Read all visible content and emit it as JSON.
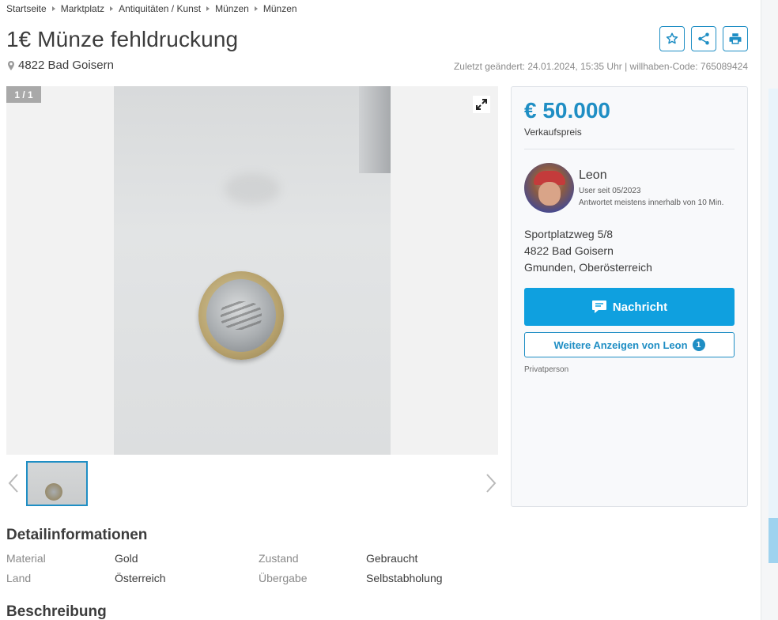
{
  "breadcrumb": [
    "Startseite",
    "Marktplatz",
    "Antiquitäten / Kunst",
    "Münzen",
    "Münzen"
  ],
  "listing": {
    "title": "1€ Münze fehldruckung",
    "location": "4822 Bad Goisern",
    "meta": "Zuletzt geändert: 24.01.2024, 15:35 Uhr | willhaben-Code: 765089424"
  },
  "actions": {
    "icons": [
      "star-icon",
      "share-icon",
      "print-icon"
    ]
  },
  "gallery": {
    "counter": "1 / 1"
  },
  "seller": {
    "price": "€ 50.000",
    "price_label": "Verkaufspreis",
    "name": "Leon",
    "user_since": "User seit 05/2023",
    "response_time": "Antwortet meistens innerhalb von 10 Min.",
    "address": {
      "street": "Sportplatzweg 5/8",
      "city": "4822 Bad Goisern",
      "region": "Gmunden, Oberösterreich"
    },
    "message_button": "Nachricht",
    "more_ads_button": "Weitere Anzeigen von Leon",
    "more_ads_count": "1",
    "seller_type": "Privatperson"
  },
  "details": {
    "title": "Detailinformationen",
    "rows": [
      {
        "label1": "Material",
        "value1": "Gold",
        "label2": "Zustand",
        "value2": "Gebraucht"
      },
      {
        "label1": "Land",
        "value1": "Österreich",
        "label2": "Übergabe",
        "value2": "Selbstabholung"
      }
    ]
  },
  "description": {
    "title": "Beschreibung"
  },
  "colors": {
    "accent": "#1f8ec4",
    "button": "#0fa0df"
  }
}
